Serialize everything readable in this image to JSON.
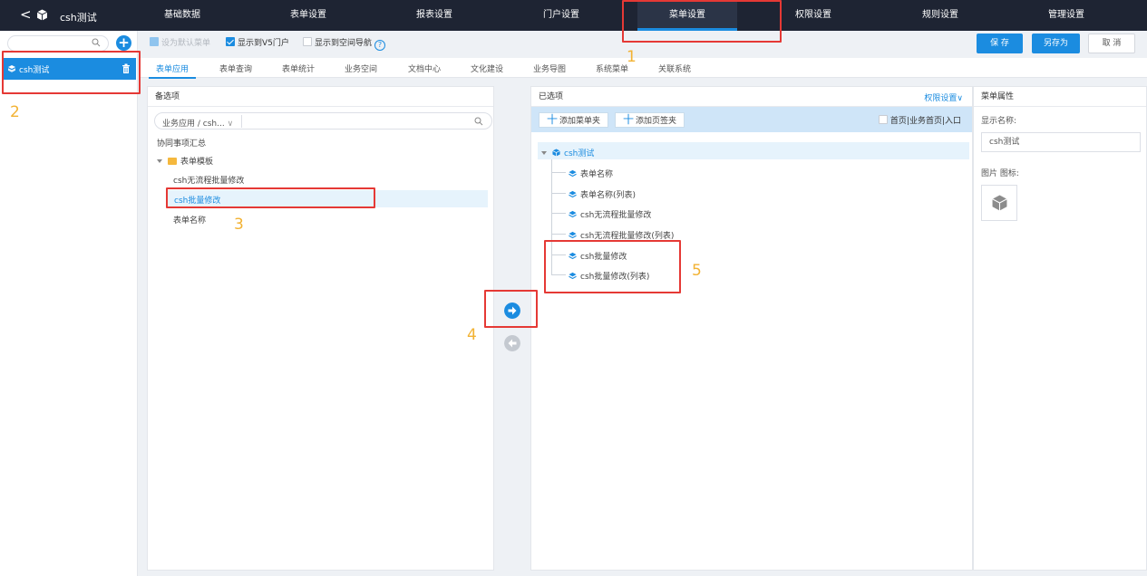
{
  "topbar": {
    "back": "<",
    "app_name": "csh测试",
    "nav": [
      "基础数据",
      "表单设置",
      "报表设置",
      "门户设置",
      "菜单设置",
      "权限设置",
      "规则设置",
      "管理设置"
    ],
    "active_nav": "菜单设置"
  },
  "sidebar": {
    "add": "+",
    "menu_item": "csh测试"
  },
  "options": {
    "default_menu": "设为默认菜单",
    "show_v5": "显示到V5门户",
    "show_space_nav": "显示到空间导航",
    "help": "?"
  },
  "actions": {
    "save": "保 存",
    "save_as": "另存为",
    "cancel": "取 消"
  },
  "tabs": [
    "表单应用",
    "表单查询",
    "表单统计",
    "业务空间",
    "文档中心",
    "文化建设",
    "业务导图",
    "系统菜单",
    "关联系统"
  ],
  "left_panel": {
    "title": "备选项",
    "category": "业务应用 / csh...",
    "category_arrow": "∨",
    "tree": {
      "root": "协同事项汇总",
      "folder": "表单模板",
      "items": [
        "csh无流程批量修改",
        "csh批量修改",
        "表单名称"
      ]
    }
  },
  "right_panel": {
    "title": "已选项",
    "perm": "权限设置∨",
    "add_folder": "添加菜单夹",
    "add_tab": "添加页签夹",
    "plus": "十",
    "home_entry": "首页|业务首页|入口",
    "root": "csh测试",
    "children": [
      "表单名称",
      "表单名称(列表)",
      "csh无流程批量修改",
      "csh无流程批量修改(列表)",
      "csh批量修改",
      "csh批量修改(列表)"
    ]
  },
  "props": {
    "title": "菜单属性",
    "display_name_label": "显示名称:",
    "display_name": "csh测试",
    "icon_label": "图片 图标:"
  },
  "annotations": [
    "1",
    "2",
    "3",
    "4",
    "5"
  ],
  "colors": {
    "accent": "#1b8ce0",
    "nav_bg": "#1e2433",
    "annotation": "#e53935",
    "number": "#f2b233"
  }
}
